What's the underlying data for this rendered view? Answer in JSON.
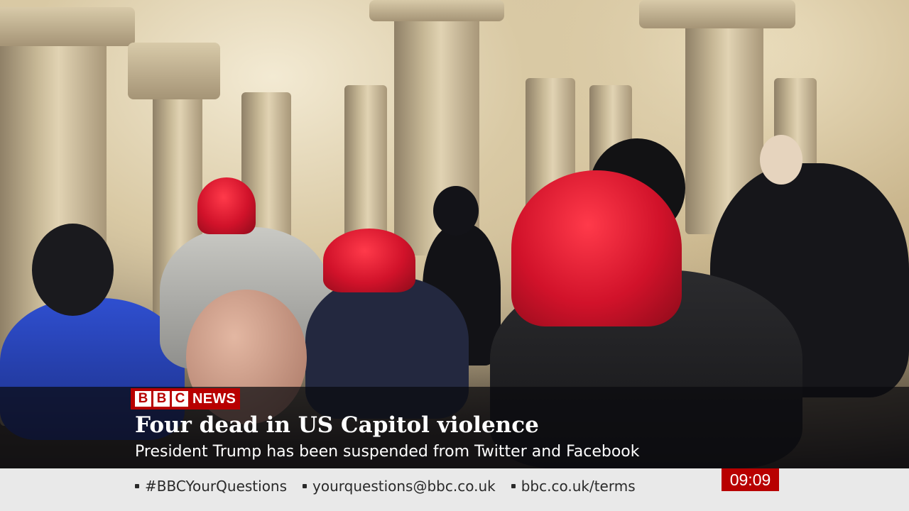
{
  "broadcast": {
    "channel_logo": {
      "letters": [
        "B",
        "B",
        "C"
      ],
      "label": "NEWS"
    },
    "headline": "Four dead in US Capitol violence",
    "subheadline": "President Trump has been suspended from Twitter and Facebook",
    "clock": "09:09"
  },
  "ticker": {
    "items": [
      "#BBCYourQuestions",
      "yourquestions@bbc.co.uk",
      "bbc.co.uk/terms"
    ]
  },
  "colors": {
    "bbc_red": "#b80000",
    "strap_background": "#0a0a0e",
    "ticker_background": "#e9e9e9"
  }
}
